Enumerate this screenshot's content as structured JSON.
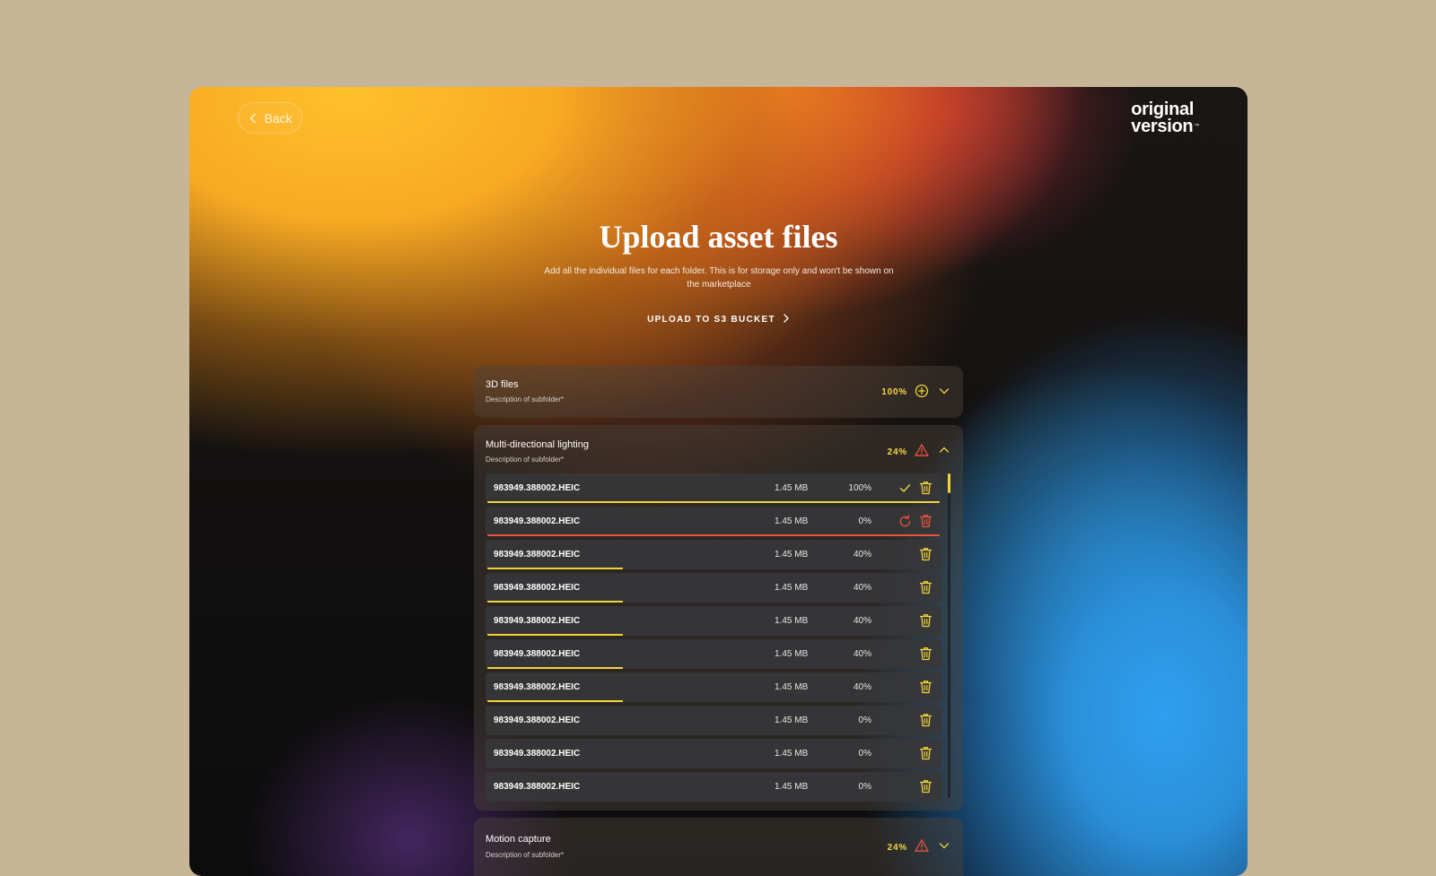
{
  "header": {
    "back_label": "Back",
    "logo_line1": "original",
    "logo_line2": "version",
    "logo_tm": "™"
  },
  "page": {
    "title": "Upload asset files",
    "subtitle": "Add all the individual files for each folder. This is for storage only and won't be shown on the marketplace",
    "upload_label": "UPLOAD TO S3 BUCKET"
  },
  "colors": {
    "accent": "#f2d43a",
    "error": "#e8553a"
  },
  "folders": [
    {
      "title": "3D files",
      "description": "Description of subfolder*",
      "percent": "100%",
      "status_icon": "plus-circle-icon",
      "expanded": false
    },
    {
      "title": "Multi-directional lighting",
      "description": "Description of subfolder*",
      "percent": "24%",
      "status_icon": "warning-icon",
      "expanded": true,
      "files": [
        {
          "name": "983949.388002.HEIC",
          "size": "1.45 MB",
          "percent": "100%",
          "progress": 1.0,
          "state": "done"
        },
        {
          "name": "983949.388002.HEIC",
          "size": "1.45 MB",
          "percent": "0%",
          "progress": 1.0,
          "state": "error"
        },
        {
          "name": "983949.388002.HEIC",
          "size": "1.45 MB",
          "percent": "40%",
          "progress": 0.3,
          "state": "uploading"
        },
        {
          "name": "983949.388002.HEIC",
          "size": "1.45 MB",
          "percent": "40%",
          "progress": 0.3,
          "state": "uploading"
        },
        {
          "name": "983949.388002.HEIC",
          "size": "1.45 MB",
          "percent": "40%",
          "progress": 0.3,
          "state": "uploading"
        },
        {
          "name": "983949.388002.HEIC",
          "size": "1.45 MB",
          "percent": "40%",
          "progress": 0.3,
          "state": "uploading"
        },
        {
          "name": "983949.388002.HEIC",
          "size": "1.45 MB",
          "percent": "40%",
          "progress": 0.3,
          "state": "uploading"
        },
        {
          "name": "983949.388002.HEIC",
          "size": "1.45 MB",
          "percent": "0%",
          "progress": 0.0,
          "state": "queued"
        },
        {
          "name": "983949.388002.HEIC",
          "size": "1.45 MB",
          "percent": "0%",
          "progress": 0.0,
          "state": "queued"
        },
        {
          "name": "983949.388002.HEIC",
          "size": "1.45 MB",
          "percent": "0%",
          "progress": 0.0,
          "state": "queued"
        }
      ]
    },
    {
      "title": "Motion capture",
      "description": "Description of subfolder*",
      "percent": "24%",
      "status_icon": "warning-icon",
      "expanded": false
    }
  ]
}
